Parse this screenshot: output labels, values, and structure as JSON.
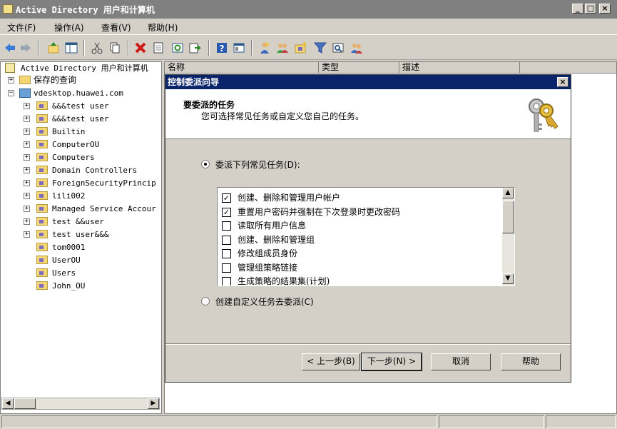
{
  "window": {
    "title": "Active Directory 用户和计算机"
  },
  "menu": [
    {
      "label": "文件(F)"
    },
    {
      "label": "操作(A)"
    },
    {
      "label": "查看(V)"
    },
    {
      "label": "帮助(H)"
    }
  ],
  "toolbar": {
    "icons": [
      "back-icon",
      "forward-icon",
      "up-icon",
      "show-hide-tree-icon",
      "cut-icon",
      "copy-icon",
      "delete-icon",
      "properties-icon",
      "refresh-icon",
      "export-icon",
      "help-icon",
      "console-icon",
      "new-user-icon",
      "new-group-icon",
      "new-ou-icon",
      "filter-icon",
      "find-icon",
      "add-to-group-icon"
    ]
  },
  "tree": {
    "root": "Active Directory 用户和计算机",
    "saved_queries": "保存的查询",
    "domain": "vdesktop.huawei.com",
    "items": [
      {
        "label": "&&&test          user",
        "expandable": true
      },
      {
        "label": "&&&test  user",
        "expandable": true
      },
      {
        "label": "Builtin",
        "expandable": true
      },
      {
        "label": "ComputerOU",
        "expandable": true
      },
      {
        "label": "Computers",
        "expandable": true
      },
      {
        "label": "Domain Controllers",
        "expandable": true
      },
      {
        "label": "ForeignSecurityPrincip",
        "expandable": true
      },
      {
        "label": "lili002",
        "expandable": true
      },
      {
        "label": "Managed Service Accour",
        "expandable": true
      },
      {
        "label": "test  &&user",
        "expandable": true
      },
      {
        "label": "test  user&&&",
        "expandable": true
      },
      {
        "label": "tom0001",
        "expandable": false
      },
      {
        "label": "UserOU",
        "expandable": false
      },
      {
        "label": "Users",
        "expandable": false
      },
      {
        "label": "John_OU",
        "expandable": false
      }
    ]
  },
  "list": {
    "columns": [
      "名称",
      "类型",
      "描述"
    ]
  },
  "dialog": {
    "title": "控制委派向导",
    "heading": "要委派的任务",
    "subheading": "您可选择常见任务或自定义您自己的任务。",
    "option_common": "委派下列常见任务(D):",
    "option_custom": "创建自定义任务去委派(C)",
    "selected_option": "common",
    "tasks": [
      {
        "label": "创建、删除和管理用户帐户",
        "checked": true
      },
      {
        "label": "重置用户密码并强制在下次登录时更改密码",
        "checked": true
      },
      {
        "label": "读取所有用户信息",
        "checked": false
      },
      {
        "label": "创建、删除和管理组",
        "checked": false
      },
      {
        "label": "修改组成员身份",
        "checked": false
      },
      {
        "label": "管理组策略链接",
        "checked": false
      },
      {
        "label": "生成策略的结果集(计划)",
        "checked": false
      }
    ],
    "buttons": {
      "back": "< 上一步(B)",
      "next": "下一步(N) >",
      "cancel": "取消",
      "help": "帮助"
    }
  },
  "colors": {
    "dialog_title_bg": "#0a246a",
    "window_title_bg": "#808080",
    "face": "#d4d0c8"
  }
}
